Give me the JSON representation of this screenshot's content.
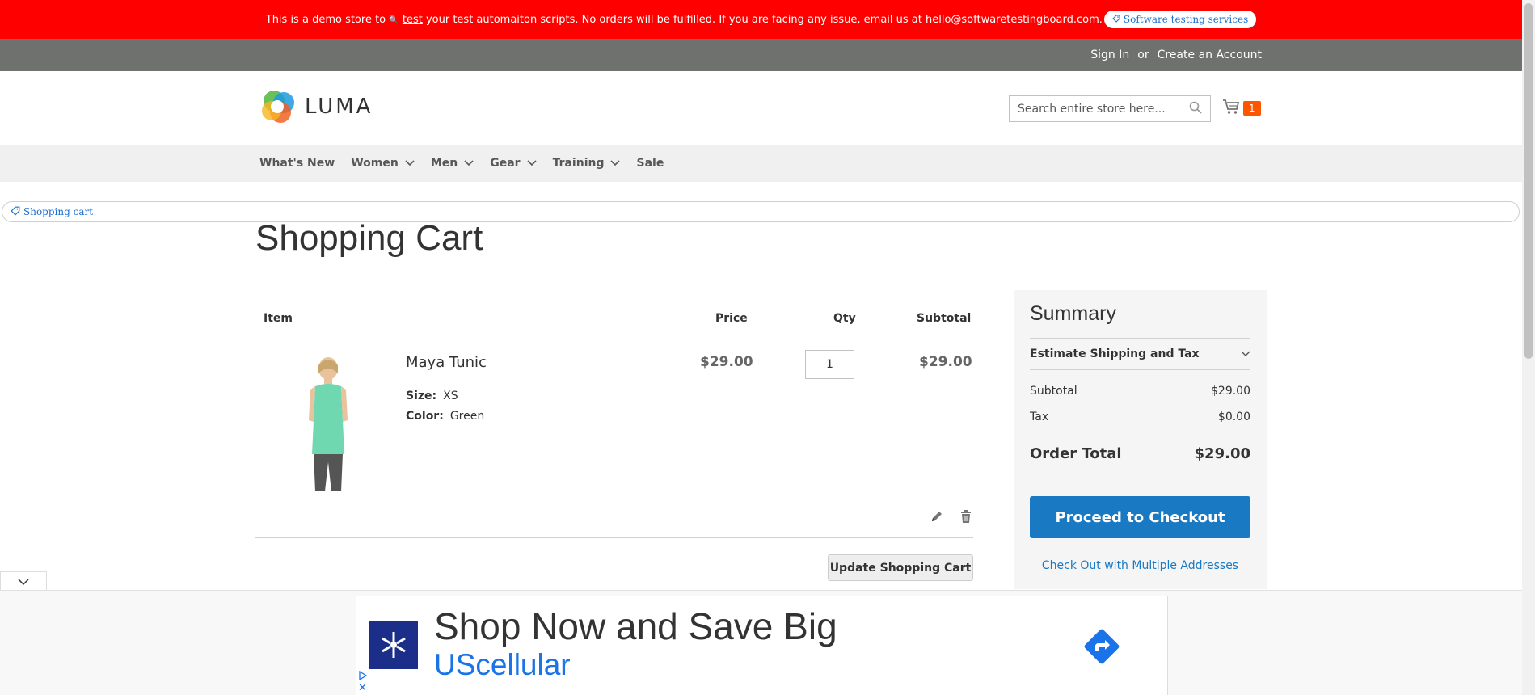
{
  "promo": {
    "text_before": "This is a demo store to ",
    "link": "test",
    "text_after": " your test automaiton scripts. No orders will be fulfilled. If you are facing any issue, email us at hello@softwaretestingboard.com.",
    "pill": "Software testing services"
  },
  "panel": {
    "sign_in": "Sign In",
    "or": "or",
    "create_account": "Create an Account"
  },
  "header": {
    "logo_text": "LUMA",
    "search_placeholder": "Search entire store here...",
    "cart_count": "1"
  },
  "nav": [
    "What's New",
    "Women",
    "Men",
    "Gear",
    "Training",
    "Sale"
  ],
  "breadcrumb": "Shopping cart",
  "page_title": "Shopping Cart",
  "cart": {
    "headers": {
      "item": "Item",
      "price": "Price",
      "qty": "Qty",
      "subtotal": "Subtotal"
    },
    "item": {
      "name": "Maya Tunic",
      "size_label": "Size:",
      "size_value": "XS",
      "color_label": "Color:",
      "color_value": "Green",
      "price": "$29.00",
      "qty": "1",
      "subtotal": "$29.00"
    },
    "update_button": "Update Shopping Cart"
  },
  "summary": {
    "title": "Summary",
    "estimate": "Estimate Shipping and Tax",
    "subtotal_label": "Subtotal",
    "subtotal_value": "$29.00",
    "tax_label": "Tax",
    "tax_value": "$0.00",
    "total_label": "Order Total",
    "total_value": "$29.00",
    "checkout": "Proceed to Checkout",
    "multi": "Check Out with Multiple Addresses"
  },
  "ad": {
    "headline": "Shop Now and Save Big",
    "brand": "UScellular"
  },
  "colors": {
    "promo_bg": "#ff0000",
    "accent": "#1979c3",
    "cart_badge": "#ff5501",
    "ad_logo_bg": "#1b2f8a"
  }
}
